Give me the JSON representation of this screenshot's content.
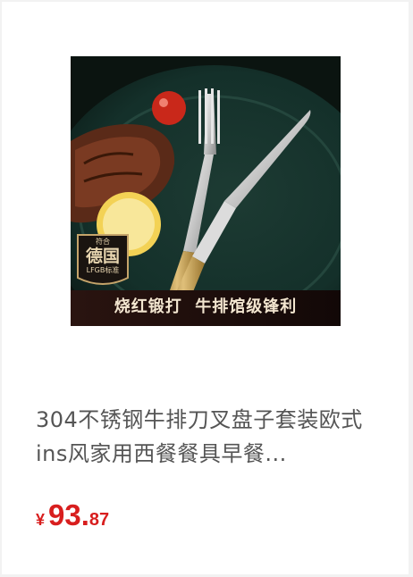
{
  "product": {
    "image": {
      "badge_top": "符合",
      "badge_main": "德国",
      "badge_bottom": "LFGB标准",
      "banner": "烧红锻打  牛排馆级锋利"
    },
    "title": "304不锈钢牛排刀叉盘子套装欧式ins风家用西餐餐具早餐...",
    "price": {
      "currency": "¥",
      "integer": "93.",
      "decimal": "87"
    },
    "colors": {
      "price": "#d81e1e",
      "title": "#555555"
    }
  }
}
